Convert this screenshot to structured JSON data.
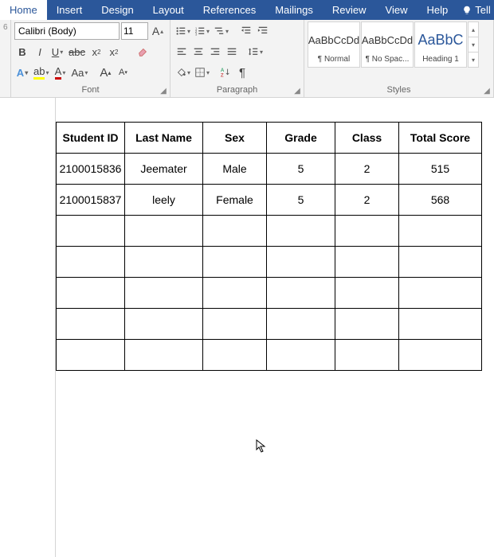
{
  "tabs": {
    "home": "Home",
    "insert": "Insert",
    "design": "Design",
    "layout": "Layout",
    "references": "References",
    "mailings": "Mailings",
    "review": "Review",
    "view": "View",
    "help": "Help",
    "tell": "Tell"
  },
  "ribbon": {
    "clipboard": {
      "trunc": "6"
    },
    "font": {
      "group_label": "Font",
      "name": "Calibri (Body)",
      "size": "11"
    },
    "paragraph": {
      "group_label": "Paragraph"
    },
    "styles": {
      "group_label": "Styles",
      "items": [
        {
          "preview": "AaBbCcDd",
          "name": "¶ Normal"
        },
        {
          "preview": "AaBbCcDd",
          "name": "¶ No Spac..."
        },
        {
          "preview": "AaBbC",
          "name": "Heading 1"
        }
      ]
    }
  },
  "doc": {
    "headers": [
      "Student ID",
      "Last Name",
      "Sex",
      "Grade",
      "Class",
      "Total Score"
    ],
    "rows": [
      [
        "2100015836",
        "Jeemater",
        "Male",
        "5",
        "2",
        "515"
      ],
      [
        "2100015837",
        "leely",
        "Female",
        "5",
        "2",
        "568"
      ],
      [
        "",
        "",
        "",
        "",
        "",
        ""
      ],
      [
        "",
        "",
        "",
        "",
        "",
        ""
      ],
      [
        "",
        "",
        "",
        "",
        "",
        ""
      ],
      [
        "",
        "",
        "",
        "",
        "",
        ""
      ],
      [
        "",
        "",
        "",
        "",
        "",
        ""
      ]
    ]
  }
}
